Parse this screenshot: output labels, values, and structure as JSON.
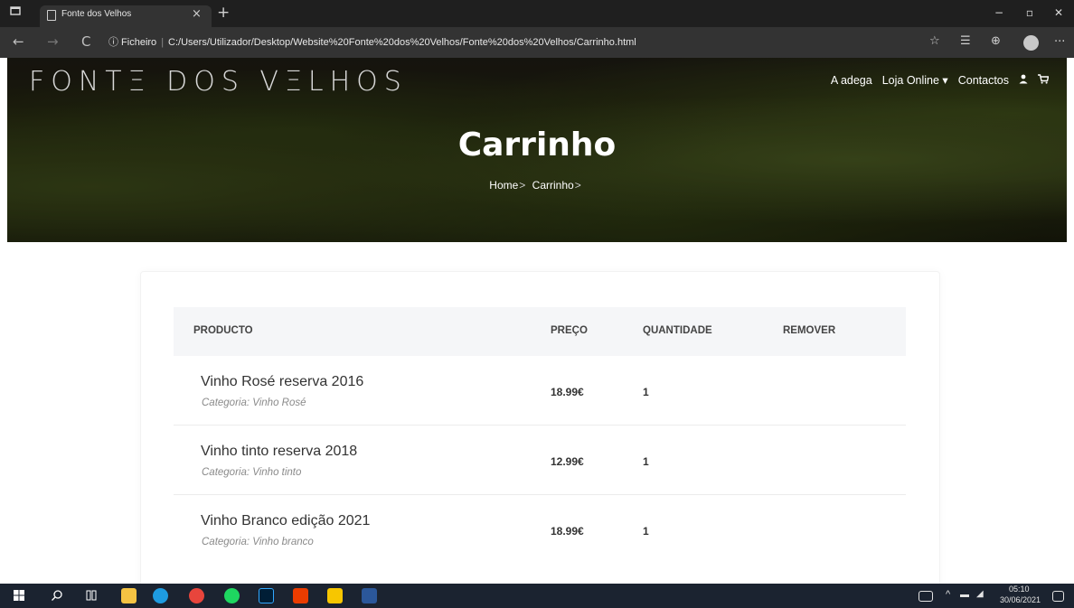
{
  "browser": {
    "tab_title": "Fonte dos Velhos",
    "tab_close": "×",
    "new_tab": "+",
    "back": "←",
    "forward": "→",
    "reload": "C",
    "url_prefix": "ⓘ Ficheiro",
    "url_separator": "|",
    "url": "C:/Users/Utilizador/Desktop/Website%20Fonte%20dos%20Velhos/Fonte%20dos%20Velhos/Carrinho.html",
    "minimize": "−",
    "maximize": "▫",
    "close": "✕",
    "more": "···",
    "icons": [
      "tab-actions-icon",
      "favorites-add-icon",
      "favorites-icon",
      "collections-icon",
      "profile-icon"
    ]
  },
  "site": {
    "brand": "FONTΞ DOS VΞLHOS",
    "nav": {
      "adega": "A adega",
      "loja": "Loja Online ▾",
      "contactos": "Contactos",
      "user_icon": "👤",
      "cart_icon": "🛒"
    }
  },
  "hero": {
    "title": "Carrinho",
    "crumb_home": "Home",
    "crumb_sep": ">",
    "crumb_current": "Carrinho",
    "crumb_sep2": ">"
  },
  "cart": {
    "headers": {
      "product": "PRODUCTO",
      "price": "PREÇO",
      "quantity": "QUANTIDADE",
      "remove": "REMOVER"
    },
    "items": [
      {
        "name": "Vinho Rosé reserva 2016",
        "category": "Categoria: Vinho Rosé",
        "price": "18.99€",
        "quantity": "1"
      },
      {
        "name": "Vinho tinto reserva 2018",
        "category": "Categoria: Vinho tinto",
        "price": "12.99€",
        "quantity": "1"
      },
      {
        "name": "Vinho Branco edição 2021",
        "category": "Categoria: Vinho branco",
        "price": "18.99€",
        "quantity": "1"
      }
    ]
  },
  "taskbar": {
    "time": "05:10",
    "date": "30/06/2021",
    "apps": [
      "windows-start",
      "search",
      "task-view",
      "file-explorer",
      "edge",
      "chrome",
      "spotify",
      "photoshop",
      "office",
      "sticky-notes",
      "word"
    ],
    "colors": {
      "explorer": "#f5c343",
      "edge": "#1e9be0",
      "chrome": "#e8453c",
      "spotify": "#1ed760",
      "photoshop": "#001e36",
      "office": "#eb3c00",
      "notes": "#f7c600",
      "word": "#2b579a"
    }
  }
}
